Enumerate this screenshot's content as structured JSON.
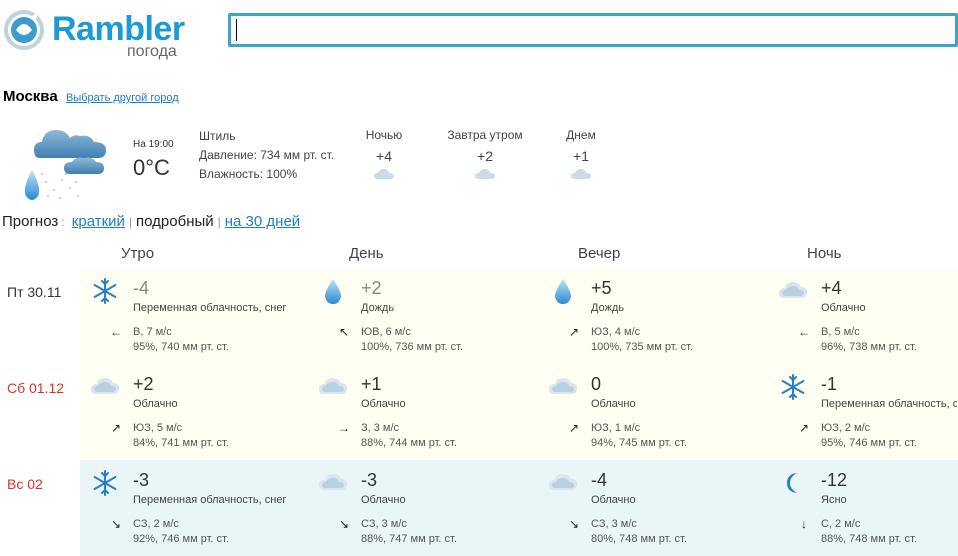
{
  "header": {
    "logo_text": "Rambler",
    "logo_sub": "погода",
    "search_value": ""
  },
  "city": {
    "name": "Москва",
    "change_link": "Выбрать другой город"
  },
  "current": {
    "time_label": "На 19:00",
    "temp": "0°C",
    "wind": "Штиль",
    "pressure": "Давление: 734  мм рт. ст.",
    "humidity": "Влажность: 100%"
  },
  "short_forecast": [
    {
      "label": "Ночью",
      "temp": "+4"
    },
    {
      "label": "Завтра утром",
      "temp": "+2"
    },
    {
      "label": "Днем",
      "temp": "+1"
    }
  ],
  "prognoz": {
    "label": "Прогноз",
    "colon": ":",
    "short": "краткий",
    "sep": "|",
    "detailed": "подробный",
    "month": "на 30 дней"
  },
  "periods": [
    "Утро",
    "День",
    "Вечер",
    "Ночь"
  ],
  "colors": {
    "accent": "#1d9ad6",
    "link": "#1d7fc4",
    "weekend": "#d9342b",
    "row_yellow": "#fffff3",
    "row_blue": "#eaf5f8"
  },
  "days": [
    {
      "date": "Пт 30.11",
      "weekend": false,
      "cells": [
        {
          "icon": "snowflake-icon",
          "temp": "-4",
          "desc": "Переменная облачность, снег",
          "arrow": "←",
          "wind": "В, 7 м/с",
          "extra": "95%, 740 мм рт. ст.",
          "temp_dim": true
        },
        {
          "icon": "raindrop-icon",
          "temp": "+2",
          "desc": "Дождь",
          "arrow": "↖",
          "wind": "ЮВ, 6 м/с",
          "extra": "100%, 736 мм рт. ст.",
          "temp_dim": true
        },
        {
          "icon": "raindrop-icon",
          "temp": "+5",
          "desc": "Дождь",
          "arrow": "↗",
          "wind": "ЮЗ, 4 м/с",
          "extra": "100%, 735 мм рт. ст.",
          "temp_dim": false
        },
        {
          "icon": "cloud-icon",
          "temp": "+4",
          "desc": "Облачно",
          "arrow": "←",
          "wind": "В, 5 м/с",
          "extra": "96%, 738 мм рт. ст.",
          "temp_dim": false
        }
      ]
    },
    {
      "date": "Сб 01.12",
      "weekend": true,
      "cells": [
        {
          "icon": "cloud-icon",
          "temp": "+2",
          "desc": "Облачно",
          "arrow": "↗",
          "wind": "ЮЗ, 5 м/с",
          "extra": "84%, 741 мм рт. ст.",
          "temp_dim": false
        },
        {
          "icon": "cloud-icon",
          "temp": "+1",
          "desc": "Облачно",
          "arrow": "→",
          "wind": "З, 3 м/с",
          "extra": "88%, 744 мм рт. ст.",
          "temp_dim": false
        },
        {
          "icon": "cloud-icon",
          "temp": "0",
          "desc": "Облачно",
          "arrow": "↗",
          "wind": "ЮЗ, 1 м/с",
          "extra": "94%, 745 мм рт. ст.",
          "temp_dim": false
        },
        {
          "icon": "snowflake-icon",
          "temp": "-1",
          "desc": "Переменная облачность, с",
          "arrow": "↗",
          "wind": "ЮЗ, 2 м/с",
          "extra": "95%, 746 мм рт. ст.",
          "temp_dim": false
        }
      ]
    },
    {
      "date": "Вс 02",
      "weekend": true,
      "cells": [
        {
          "icon": "snowflake-icon",
          "temp": "-3",
          "desc": "Переменная облачность, снег",
          "arrow": "↘",
          "wind": "СЗ, 2 м/с",
          "extra": "92%, 746 мм рт. ст.",
          "temp_dim": false
        },
        {
          "icon": "cloud-icon",
          "temp": "-3",
          "desc": "Облачно",
          "arrow": "↘",
          "wind": "СЗ, 3 м/с",
          "extra": "88%, 747 мм рт. ст.",
          "temp_dim": false
        },
        {
          "icon": "cloud-icon",
          "temp": "-4",
          "desc": "Облачно",
          "arrow": "↘",
          "wind": "СЗ, 3 м/с",
          "extra": "80%, 748 мм рт. ст.",
          "temp_dim": false
        },
        {
          "icon": "moon-icon",
          "temp": "-12",
          "desc": "Ясно",
          "arrow": "↓",
          "wind": "С, 2 м/с",
          "extra": "88%, 748 мм рт. ст.",
          "temp_dim": false
        }
      ]
    }
  ]
}
